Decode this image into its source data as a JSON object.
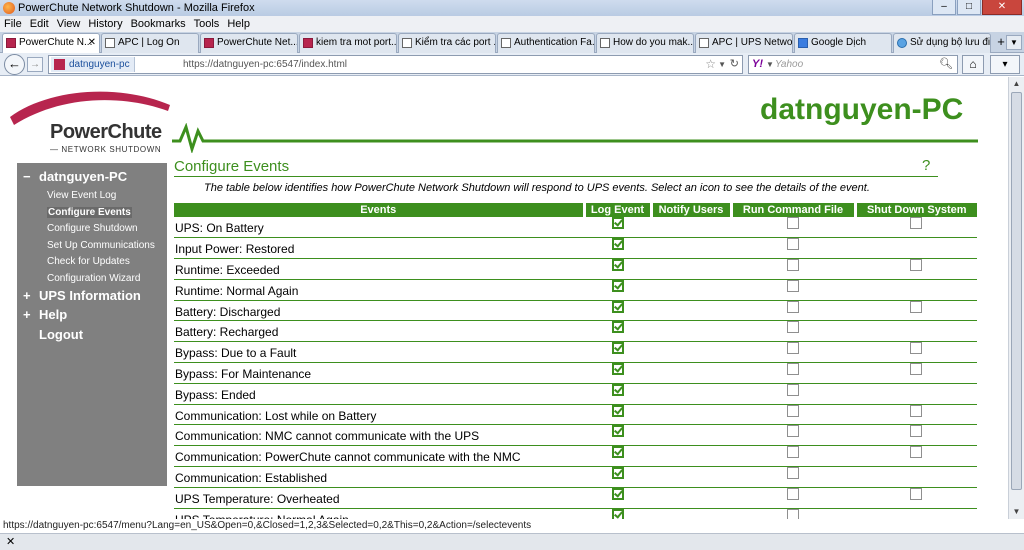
{
  "window": {
    "title": "PowerChute Network Shutdown - Mozilla Firefox"
  },
  "menubar": [
    "File",
    "Edit",
    "View",
    "History",
    "Bookmarks",
    "Tools",
    "Help"
  ],
  "tabs": [
    {
      "label": "PowerChute N...",
      "icon": "pc",
      "active": true
    },
    {
      "label": "APC | Log On",
      "icon": "doc",
      "active": false
    },
    {
      "label": "PowerChute Net...",
      "icon": "pc",
      "active": false
    },
    {
      "label": "kiem tra mot port...",
      "icon": "pc",
      "active": false
    },
    {
      "label": "Kiểm tra các port ...",
      "icon": "doc",
      "active": false
    },
    {
      "label": "Authentication Fa...",
      "icon": "doc",
      "active": false
    },
    {
      "label": "How do you mak...",
      "icon": "doc",
      "active": false
    },
    {
      "label": "APC | UPS Networ...",
      "icon": "doc",
      "active": false
    },
    {
      "label": "Google Dịch",
      "icon": "google",
      "active": false
    },
    {
      "label": "Sử dụng bộ lưu đi...",
      "icon": "globe",
      "active": false
    }
  ],
  "nav": {
    "site_label": "datnguyen-pc",
    "url": "https://datnguyen-pc:6547/index.html",
    "search_placeholder": "Yahoo"
  },
  "logo": {
    "brand": "PowerChute",
    "sub": "— NETWORK SHUTDOWN"
  },
  "header": {
    "hostname": "datnguyen-PC"
  },
  "sidebar": {
    "host": {
      "marker": "−",
      "label": "datnguyen-PC"
    },
    "items": [
      {
        "label": "View Event Log",
        "selected": false
      },
      {
        "label": "Configure Events",
        "selected": true
      },
      {
        "label": "Configure Shutdown",
        "selected": false
      },
      {
        "label": "Set Up Communications",
        "selected": false
      },
      {
        "label": "Check for Updates",
        "selected": false
      },
      {
        "label": "Configuration Wizard",
        "selected": false
      }
    ],
    "ups": {
      "marker": "+",
      "label": "UPS Information"
    },
    "help": {
      "marker": "+",
      "label": "Help"
    },
    "logout": {
      "label": "Logout"
    }
  },
  "content": {
    "title": "Configure Events",
    "help_label": "?",
    "intro": "The table below identifies how PowerChute Network Shutdown will respond to UPS events. Select an icon to see the details of the event."
  },
  "table": {
    "headers": [
      "Events",
      "Log Event",
      "Notify Users",
      "Run Command File",
      "Shut Down System"
    ],
    "rows": [
      {
        "event": "UPS: On Battery",
        "log": true,
        "cmd": false,
        "shutdown": false
      },
      {
        "event": "Input Power: Restored",
        "log": true,
        "cmd": false,
        "shutdown": null
      },
      {
        "event": "Runtime: Exceeded",
        "log": true,
        "cmd": false,
        "shutdown": false
      },
      {
        "event": "Runtime: Normal Again",
        "log": true,
        "cmd": false,
        "shutdown": null
      },
      {
        "event": "Battery: Discharged",
        "log": true,
        "cmd": false,
        "shutdown": false
      },
      {
        "event": "Battery: Recharged",
        "log": true,
        "cmd": false,
        "shutdown": null
      },
      {
        "event": "Bypass: Due to a Fault",
        "log": true,
        "cmd": false,
        "shutdown": false
      },
      {
        "event": "Bypass: For Maintenance",
        "log": true,
        "cmd": false,
        "shutdown": false
      },
      {
        "event": "Bypass: Ended",
        "log": true,
        "cmd": false,
        "shutdown": null
      },
      {
        "event": "Communication: Lost while on Battery",
        "log": true,
        "cmd": false,
        "shutdown": false
      },
      {
        "event": "Communication: NMC cannot communicate with the UPS",
        "log": true,
        "cmd": false,
        "shutdown": false
      },
      {
        "event": "Communication: PowerChute cannot communicate with the NMC",
        "log": true,
        "cmd": false,
        "shutdown": false
      },
      {
        "event": "Communication: Established",
        "log": true,
        "cmd": false,
        "shutdown": null
      },
      {
        "event": "UPS Temperature: Overheated",
        "log": true,
        "cmd": false,
        "shutdown": false
      },
      {
        "event": "UPS Temperature: Normal Again",
        "log": true,
        "cmd": false,
        "shutdown": null
      },
      {
        "event": "",
        "log": true,
        "cmd": null,
        "shutdown": null
      }
    ]
  },
  "statusbar": {
    "text": "https://datnguyen-pc:6547/menu?Lang=en_US&Open=0,&Closed=1,2,3&Selected=0,2&This=0,2&Action=/selectevents"
  },
  "colors": {
    "accent": "#3d8f1e",
    "sidebar": "#808080",
    "logo_swoosh": "#b7254e"
  }
}
